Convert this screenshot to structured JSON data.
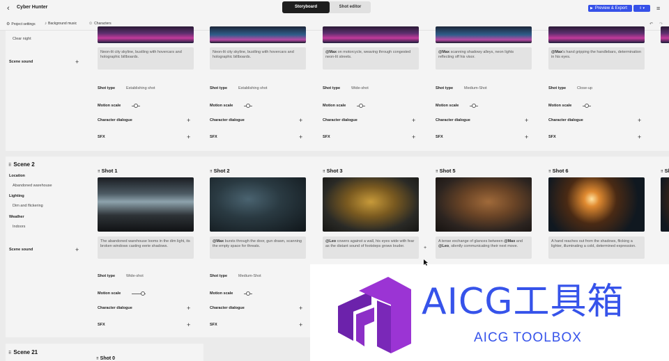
{
  "topbar": {
    "app_title": "Cyber Hunter",
    "tabs": [
      {
        "label": "Storyboard",
        "active": true
      },
      {
        "label": "Shot editor",
        "active": false
      }
    ],
    "preview_export_label": "Preview & Export"
  },
  "toolbar": {
    "project_settings": "Project settings",
    "background_music": "Background music",
    "characters": "Characters"
  },
  "scene1": {
    "weather_value": "Clear night",
    "scene_sound_label": "Scene sound",
    "shots": [
      {
        "desc_pre": "",
        "mention": "",
        "desc": "Neon-lit city skyline, bustling with hovercars and holographic billboards.",
        "shot_type": "Establishing shot",
        "motion": 0.5,
        "img": "neon"
      },
      {
        "desc_pre": "",
        "mention": "",
        "desc": "Neon-lit city skyline, bustling with hovercars and holographic billboards.",
        "shot_type": "Establishing shot",
        "motion": 0.5,
        "img": "neon2"
      },
      {
        "desc_pre": "",
        "mention": "@Max",
        "desc": " on motorcycle, weaving through congested neon-lit streets.",
        "shot_type": "Wide-shot",
        "motion": 0.5,
        "img": "neon"
      },
      {
        "desc_pre": "",
        "mention": "@Max",
        "desc": " scanning shadowy alleys, neon lights reflecting off his visor.",
        "shot_type": "Medium-Shot",
        "motion": 0.5,
        "img": "neon2"
      },
      {
        "desc_pre": "",
        "mention": "@Max",
        "desc": "'s hand gripping the handlebars, determination in his eyes.",
        "shot_type": "Close-up",
        "motion": 0.5,
        "img": "neon"
      }
    ]
  },
  "labels": {
    "shot_type": "Shot type",
    "motion_scale": "Motion scale",
    "character_dialogue": "Character dialogue",
    "sfx": "SFX",
    "location": "Location",
    "lighting": "Lighting",
    "weather": "Weather",
    "scene_sound": "Scene sound"
  },
  "scene2": {
    "title": "Scene 2",
    "location": "Abandoned warehouse",
    "lighting": "Dim and flickering",
    "weather": "Indoors",
    "shots": [
      {
        "title": "Shot 1",
        "desc_pre": "",
        "mention": "",
        "mention2": "",
        "desc": "The abandoned warehouse looms in the dim light, its broken windows casting eerie shadows.",
        "shot_type": "Wide-shot",
        "motion": 0.9,
        "img": "warehouse"
      },
      {
        "title": "Shot 2",
        "desc_pre": "",
        "mention": "@Max",
        "mention2": "",
        "desc": " bursts through the door, gun drawn, scanning the empty space for threats.",
        "shot_type": "Medium-Shot",
        "motion": 0.5,
        "img": "man1"
      },
      {
        "title": "Shot 3",
        "desc_pre": "",
        "mention": "@Leo",
        "mention2": "",
        "desc": " cowers against a wall, his eyes wide with fear as the distant sound of footsteps grows louder.",
        "shot_type": "",
        "motion": null,
        "img": "man2"
      },
      {
        "title": "Shot 5",
        "desc_pre": "A tense exchange of glances between ",
        "mention": "@Max",
        "mention2": "@Leo",
        "desc": ", silently communicating their next move.",
        "shot_type": "",
        "motion": null,
        "img": "man3"
      },
      {
        "title": "Shot 6",
        "desc_pre": "",
        "mention": "",
        "mention2": "",
        "desc": "A hand reaches out from the shadows, flicking a lighter, illuminating a cold, determined expression.",
        "shot_type": "",
        "motion": null,
        "img": "lighter"
      },
      {
        "title": "Sh"
      }
    ]
  },
  "scene21": {
    "title": "Scene 21",
    "first_shot": "Shot 0"
  },
  "watermark": {
    "title": "AICG工具箱",
    "subtitle": "AICG TOOLBOX",
    "color": "#3653ea",
    "logo_color": "#8c2fc7"
  },
  "colors": {
    "accent": "#3651e8",
    "tab_active_bg": "#1e1e1e"
  }
}
